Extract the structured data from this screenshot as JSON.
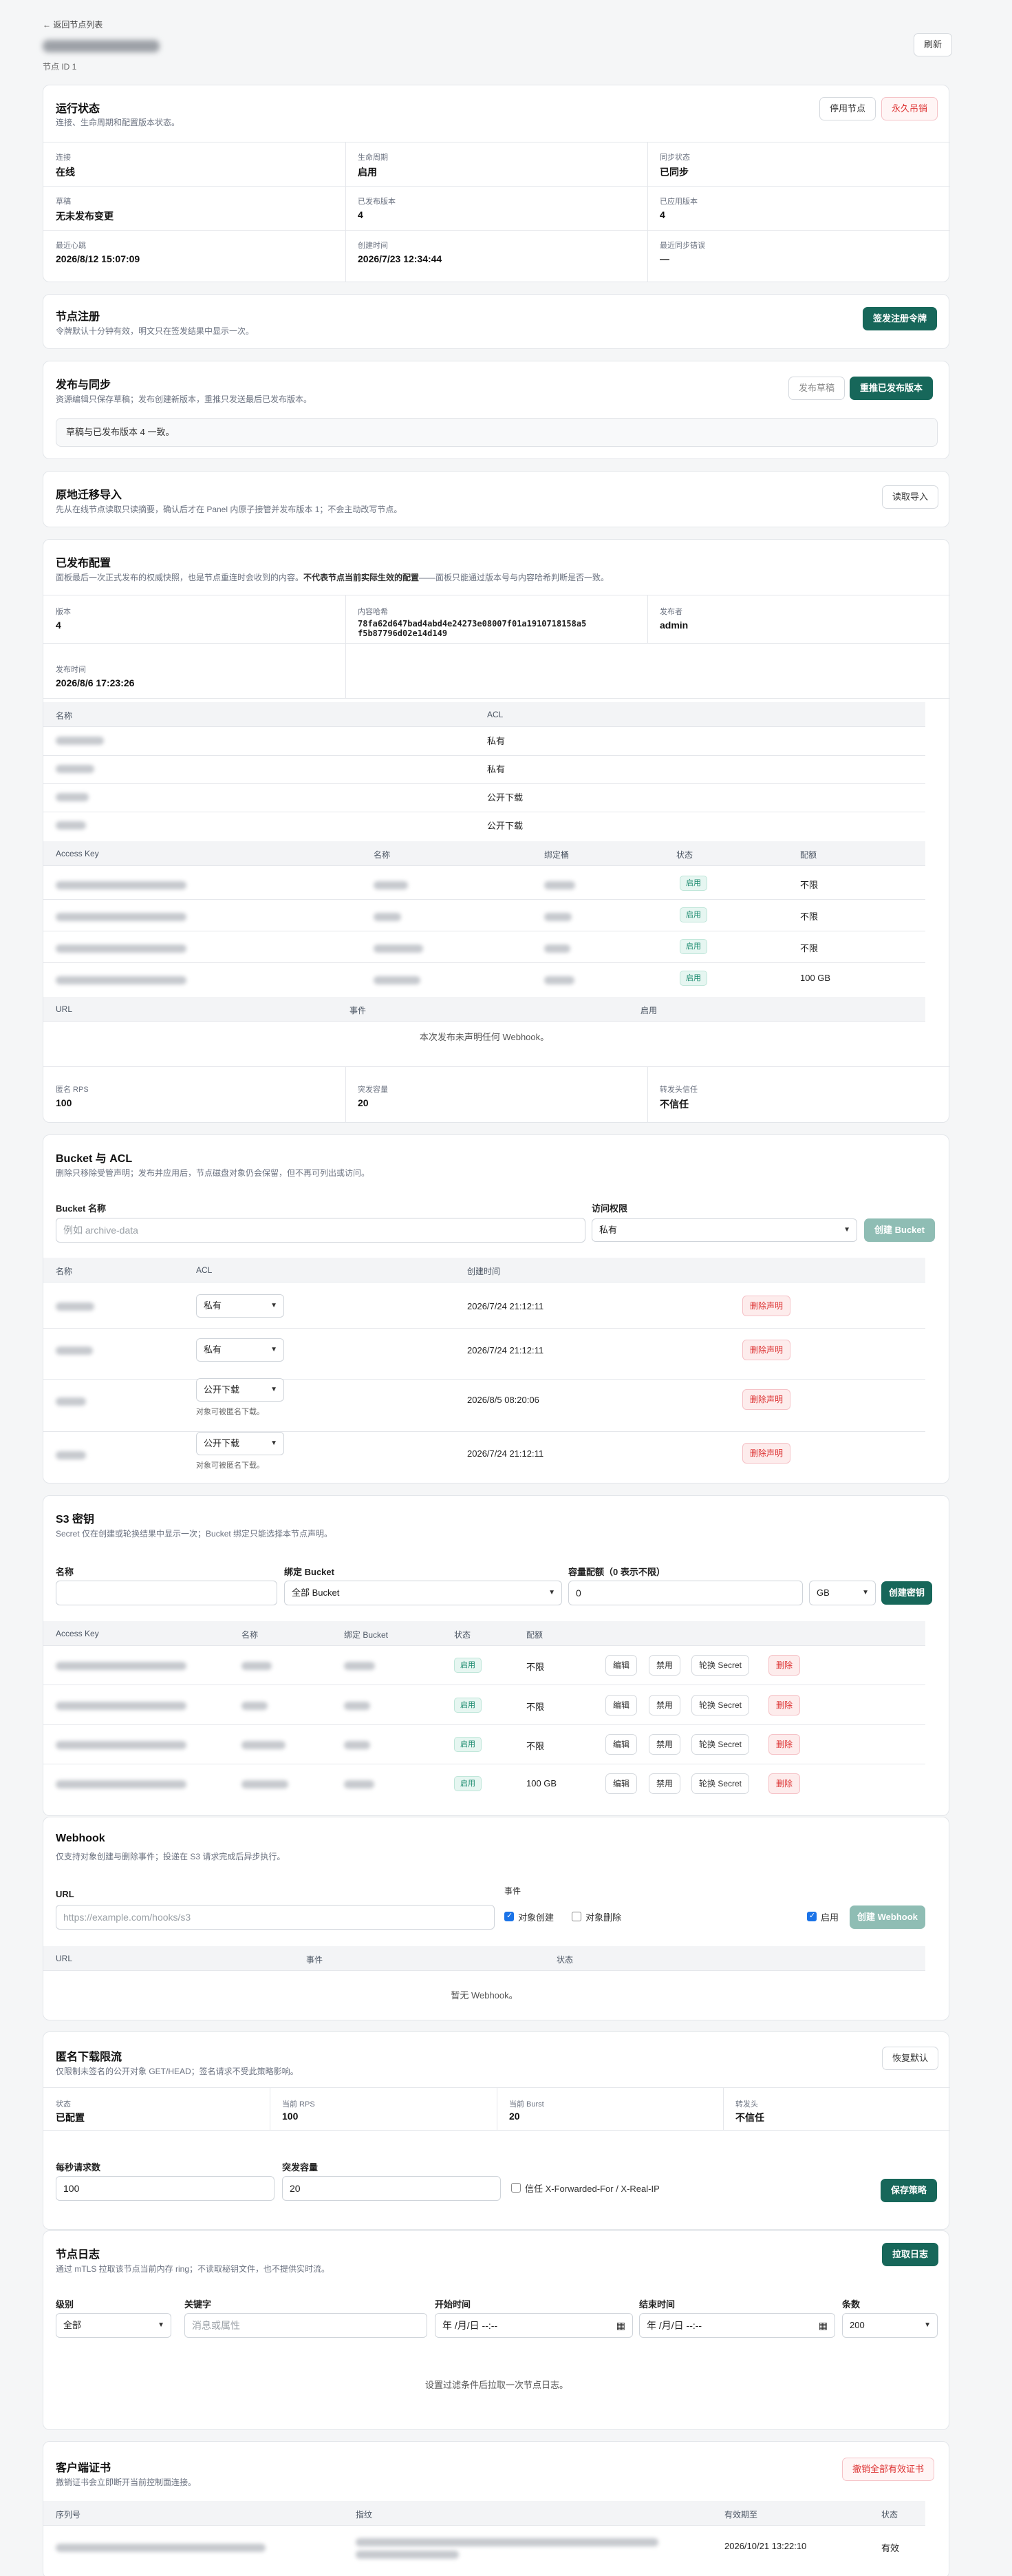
{
  "header": {
    "back": "← 返回节点列表",
    "node_id": "节点 ID 1",
    "refresh": "刷新"
  },
  "status": {
    "title": "运行状态",
    "subtitle": "连接、生命周期和配置版本状态。",
    "btn_disable": "停用节点",
    "btn_revoke": "永久吊销",
    "fields": [
      {
        "label": "连接",
        "value": "在线"
      },
      {
        "label": "生命周期",
        "value": "启用"
      },
      {
        "label": "同步状态",
        "value": "已同步"
      },
      {
        "label": "草稿",
        "value": "无未发布变更"
      },
      {
        "label": "已发布版本",
        "value": "4"
      },
      {
        "label": "已应用版本",
        "value": "4"
      },
      {
        "label": "最近心跳",
        "value": "2026/8/12 15:07:09"
      },
      {
        "label": "创建时间",
        "value": "2026/7/23 12:34:44"
      },
      {
        "label": "最近同步错误",
        "value": "—"
      }
    ]
  },
  "register": {
    "title": "节点注册",
    "subtitle": "令牌默认十分钟有效，明文只在签发结果中显示一次。",
    "button": "签发注册令牌"
  },
  "publish": {
    "title": "发布与同步",
    "subtitle": "资源编辑只保存草稿；发布创建新版本，重推只发送最后已发布版本。",
    "btn_publish": "发布草稿",
    "btn_repush": "重推已发布版本",
    "notice": "草稿与已发布版本 4 一致。"
  },
  "migrate": {
    "title": "原地迁移导入",
    "subtitle": "先从在线节点读取只读摘要，确认后才在 Panel 内原子接管并发布版本 1；不会主动改写节点。",
    "button": "读取导入"
  },
  "published": {
    "title": "已发布配置",
    "subtitle_a": "面板最后一次正式发布的权威快照，也是节点重连时会收到的内容。",
    "subtitle_b": "不代表节点当前实际生效的配置",
    "subtitle_c": "——面板只能通过版本号与内容哈希判断是否一致。",
    "version_label": "版本",
    "version": "4",
    "hash_label": "内容哈希",
    "hash_line1": "78fa62d647bad4abd4e24273e08007f01a1910718158a5",
    "hash_line2": "f5b87796d02e14d149",
    "publisher_label": "发布者",
    "publisher": "admin",
    "time_label": "发布时间",
    "time": "2026/8/6 17:23:26",
    "bucket_cols": [
      "名称",
      "ACL"
    ],
    "bucket_acls": [
      "私有",
      "私有",
      "公开下载",
      "公开下载"
    ],
    "key_cols": [
      "Access Key",
      "名称",
      "绑定桶",
      "状态",
      "配额"
    ],
    "key_status": [
      "启用",
      "启用",
      "启用",
      "启用"
    ],
    "key_quota": [
      "不限",
      "不限",
      "不限",
      "100 GB"
    ],
    "webhook_cols": [
      "URL",
      "事件",
      "启用"
    ],
    "webhook_empty": "本次发布未声明任何 Webhook。",
    "rps_label": "匿名 RPS",
    "rps": "100",
    "burst_label": "突发容量",
    "burst": "20",
    "trust_label": "转发头信任",
    "trust": "不信任"
  },
  "buckets": {
    "title": "Bucket 与 ACL",
    "subtitle": "删除只移除受管声明；发布并应用后，节点磁盘对象仍会保留，但不再可列出或访问。",
    "name_label": "Bucket 名称",
    "name_placeholder": "例如 archive-data",
    "acl_label": "访问权限",
    "acl_value": "私有",
    "create": "创建 Bucket",
    "cols": [
      "名称",
      "ACL",
      "创建时间"
    ],
    "rows": [
      {
        "acl": "私有",
        "time": "2026/7/24 21:12:11",
        "note": ""
      },
      {
        "acl": "私有",
        "time": "2026/7/24 21:12:11",
        "note": ""
      },
      {
        "acl": "公开下载",
        "time": "2026/8/5 08:20:06",
        "note": "对象可被匿名下载。"
      },
      {
        "acl": "公开下载",
        "time": "2026/7/24 21:12:11",
        "note": "对象可被匿名下载。"
      }
    ],
    "delete": "删除声明"
  },
  "s3keys": {
    "title": "S3 密钥",
    "subtitle": "Secret 仅在创建或轮换结果中显示一次；Bucket 绑定只能选择本节点声明。",
    "name_label": "名称",
    "bind_label": "绑定 Bucket",
    "bind_value": "全部 Bucket",
    "quota_label": "容量配额（0 表示不限）",
    "quota_value": "0",
    "unit": "GB",
    "create": "创建密钥",
    "cols": [
      "Access Key",
      "名称",
      "绑定 Bucket",
      "状态",
      "配额"
    ],
    "rows": [
      {
        "status": "启用",
        "quota": "不限"
      },
      {
        "status": "启用",
        "quota": "不限"
      },
      {
        "status": "启用",
        "quota": "不限"
      },
      {
        "status": "启用",
        "quota": "100 GB"
      }
    ],
    "edit": "编辑",
    "disable": "禁用",
    "rotate": "轮换 Secret",
    "delete": "删除"
  },
  "webhook": {
    "title": "Webhook",
    "subtitle": "仅支持对象创建与删除事件；投递在 S3 请求完成后异步执行。",
    "url_label": "URL",
    "url_placeholder": "https://example.com/hooks/s3",
    "events_label": "事件",
    "ev_create": "对象创建",
    "ev_delete": "对象删除",
    "enabled": "启用",
    "create": "创建 Webhook",
    "cols": [
      "URL",
      "事件",
      "状态"
    ],
    "empty": "暂无 Webhook。"
  },
  "anon": {
    "title": "匿名下载限流",
    "subtitle": "仅限制未签名的公开对象 GET/HEAD；签名请求不受此策略影响。",
    "restore": "恢复默认",
    "fields": [
      {
        "label": "状态",
        "value": "已配置"
      },
      {
        "label": "当前 RPS",
        "value": "100"
      },
      {
        "label": "当前 Burst",
        "value": "20"
      },
      {
        "label": "转发头",
        "value": "不信任"
      }
    ],
    "rps_label": "每秒请求数",
    "rps_value": "100",
    "burst_label": "突发容量",
    "burst_value": "20",
    "trust": "信任 X-Forwarded-For / X-Real-IP",
    "save": "保存策略"
  },
  "logs": {
    "title": "节点日志",
    "subtitle": "通过 mTLS 拉取该节点当前内存 ring；不读取秘钥文件，也不提供实时流。",
    "pull": "拉取日志",
    "level_label": "级别",
    "level_value": "全部",
    "kw_label": "关键字",
    "kw_placeholder": "消息或属性",
    "start_label": "开始时间",
    "end_label": "结束时间",
    "date_placeholder": "年 /月/日 --:--",
    "count_label": "条数",
    "count_value": "200",
    "empty": "设置过滤条件后拉取一次节点日志。"
  },
  "certs": {
    "title": "客户端证书",
    "subtitle": "撤销证书会立即断开当前控制面连接。",
    "revoke_all": "撤销全部有效证书",
    "cols": [
      "序列号",
      "指纹",
      "有效期至",
      "状态"
    ],
    "row": {
      "expiry": "2026/10/21 13:22:10",
      "status": "有效"
    }
  }
}
